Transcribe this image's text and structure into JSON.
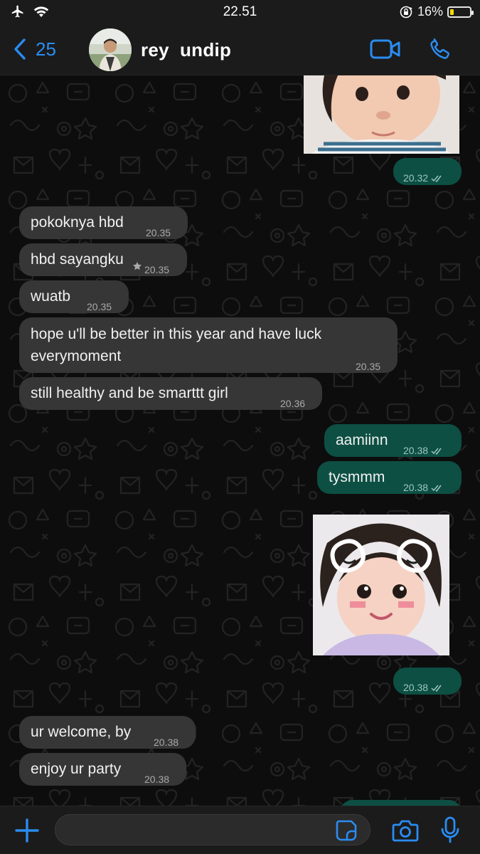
{
  "status_bar": {
    "time": "22.51",
    "battery_percent_label": "16%",
    "battery_level": 0.16,
    "icons": [
      "airplane-icon",
      "wifi-icon",
      "orientation-lock-icon",
      "battery-icon"
    ]
  },
  "header": {
    "back_count": "25",
    "contact_name": "rey  undip",
    "icons": [
      "chevron-left-icon",
      "video-call-icon",
      "phone-call-icon"
    ]
  },
  "messages": [
    {
      "type": "image",
      "direction": "out",
      "subject": "girl photo",
      "time": "20.32",
      "read": true
    },
    {
      "type": "text",
      "direction": "in",
      "text": "pokoknya hbd",
      "time": "20.35"
    },
    {
      "type": "text",
      "direction": "in",
      "text": "hbd sayangku",
      "time": "20.35",
      "starred": true
    },
    {
      "type": "text",
      "direction": "in",
      "text": "wuatb",
      "time": "20.35"
    },
    {
      "type": "text",
      "direction": "in",
      "text": "hope u'll be better in this year and have luck",
      "text2": "everymoment",
      "time": "20.35"
    },
    {
      "type": "text",
      "direction": "in",
      "text": "still healthy and be smarttt girl",
      "time": "20.36"
    },
    {
      "type": "text",
      "direction": "out",
      "text": "aamiinn",
      "time": "20.38",
      "read": true
    },
    {
      "type": "text",
      "direction": "out",
      "text": "tysmmm",
      "time": "20.38",
      "read": true
    },
    {
      "type": "image",
      "direction": "out",
      "subject": "girl photo with bunny ears",
      "time": "20.38",
      "read": true
    },
    {
      "type": "text",
      "direction": "in",
      "text": "ur welcome, by",
      "time": "20.38"
    },
    {
      "type": "text",
      "direction": "in",
      "text": "enjoy ur party",
      "time": "20.38"
    }
  ],
  "input_bar": {
    "placeholder": "",
    "value": "",
    "icons": [
      "plus-icon",
      "sticker-icon",
      "camera-icon",
      "microphone-icon"
    ]
  },
  "colors": {
    "accent": "#2a8cf1",
    "incoming_bubble": "#363636",
    "outgoing_bubble": "#0d4f43",
    "background": "#0d0d0d"
  }
}
